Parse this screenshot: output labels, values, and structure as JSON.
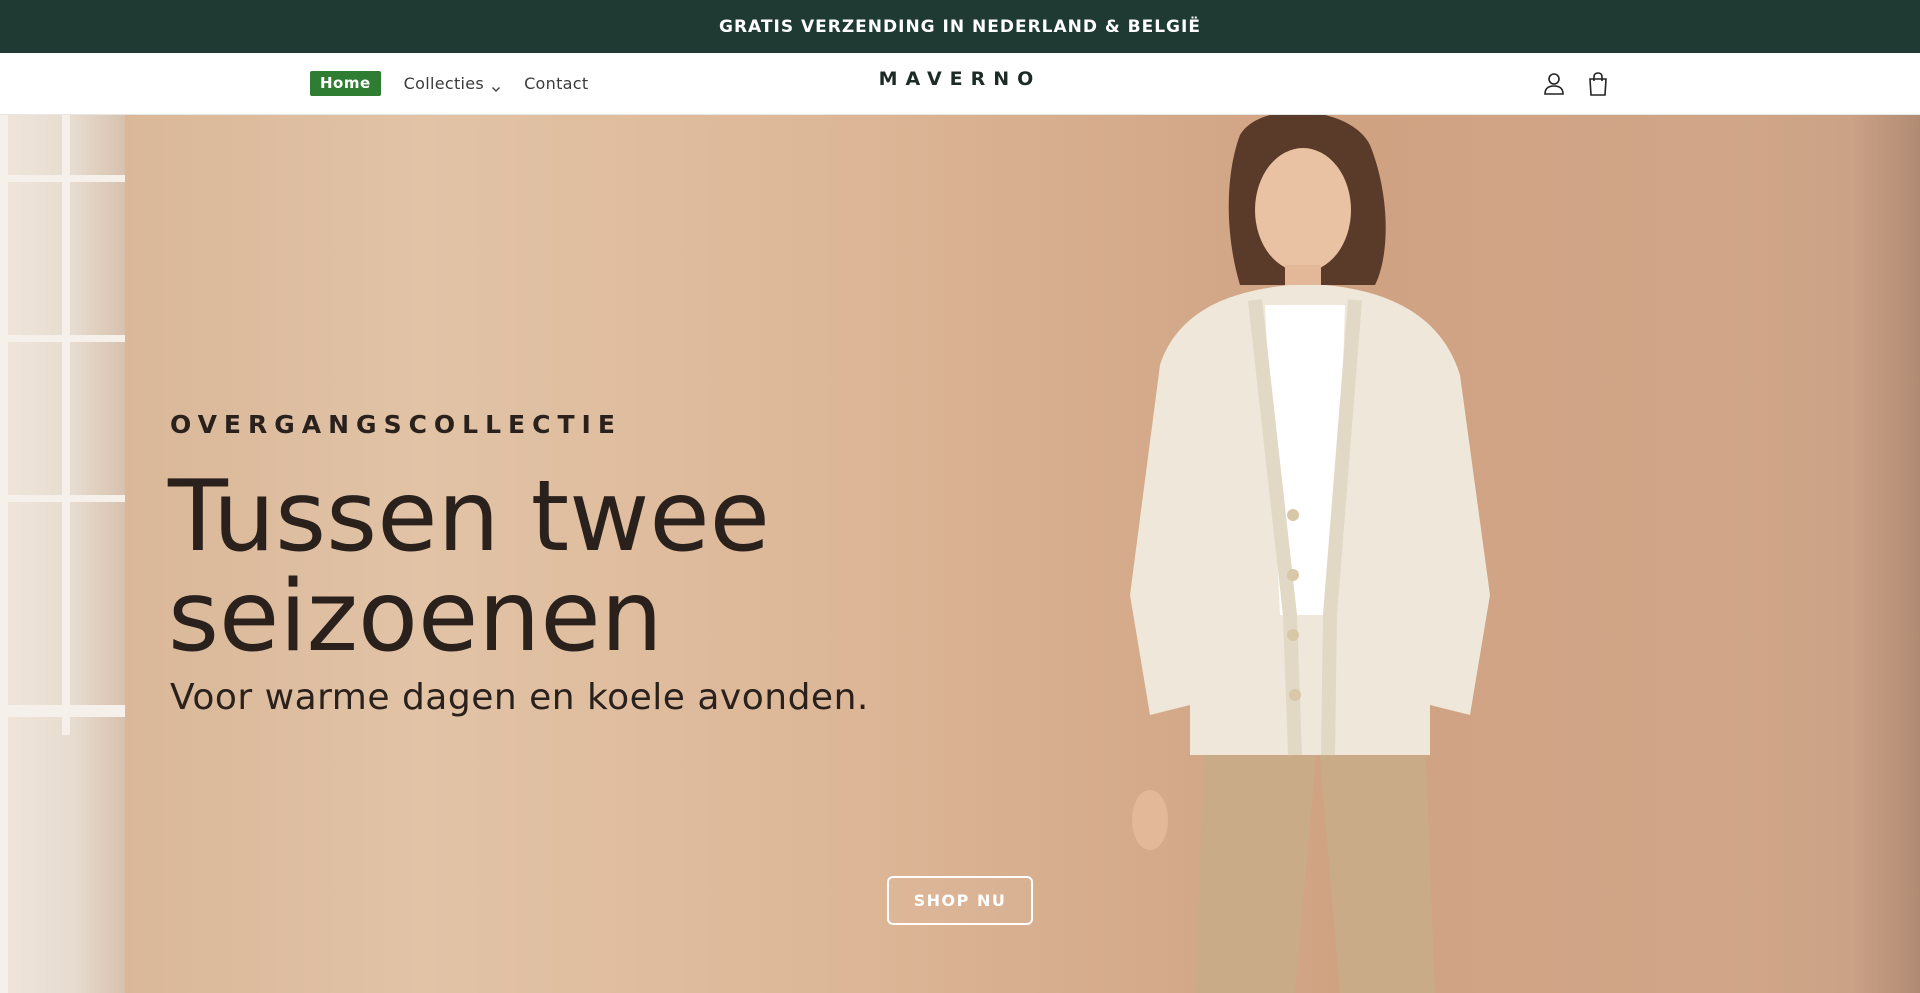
{
  "announcement": {
    "text": "GRATIS VERZENDING IN NEDERLAND & BELGIË"
  },
  "header": {
    "logo": "MAVERNO",
    "nav": [
      {
        "label": "Home",
        "active": true
      },
      {
        "label": "Collecties",
        "has_dropdown": true
      },
      {
        "label": "Contact"
      }
    ],
    "icons": [
      "account-icon",
      "cart-icon"
    ]
  },
  "hero": {
    "eyebrow": "OVERGANGSCOLLECTIE",
    "headline_line1": "Tussen twee",
    "headline_line2": "seizoenen",
    "subline": "Voor warme dagen en koele avonden.",
    "cta_label": "SHOP NU"
  },
  "colors": {
    "announcement_bg": "#1f3a33",
    "active_nav_bg": "#2e7d32",
    "text_dark": "#2a211d"
  }
}
